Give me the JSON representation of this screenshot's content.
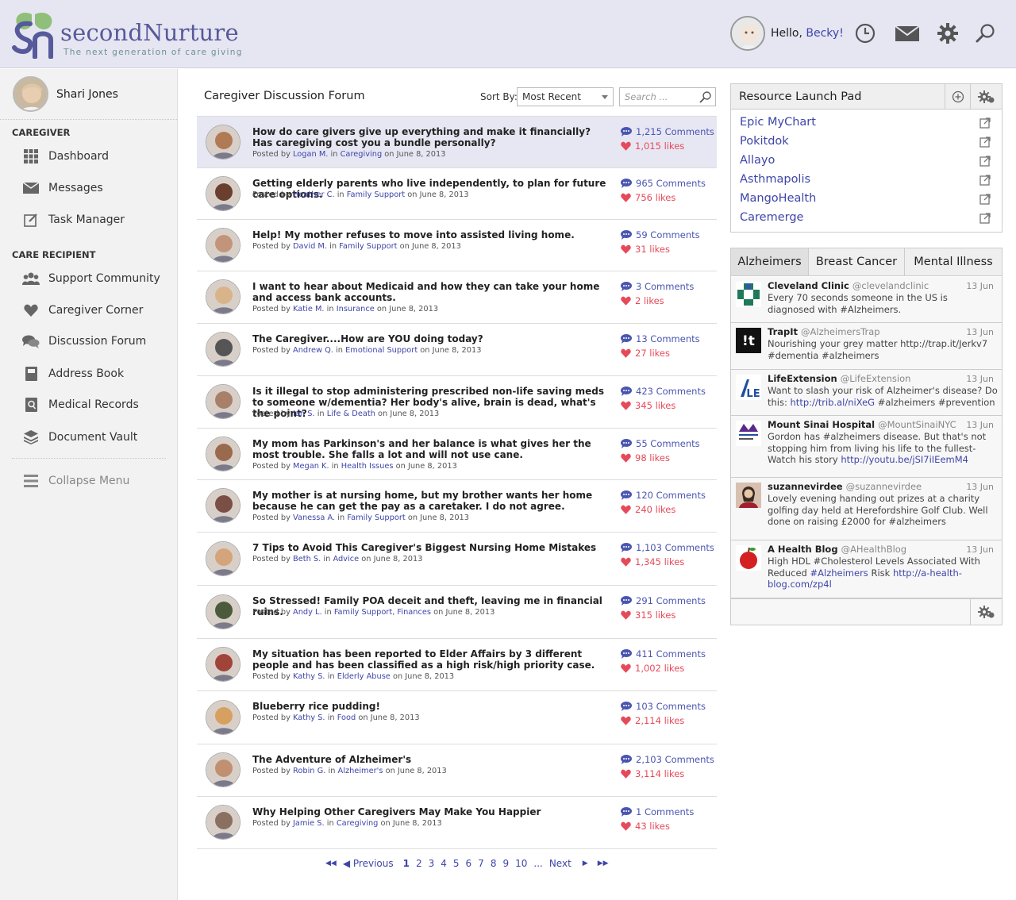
{
  "app": {
    "name": "secondNurture",
    "tagline": "The next generation of care giving",
    "accent_color": "#56599a",
    "link_color": "#3e45a8"
  },
  "header": {
    "greeting": "Hello,",
    "user_name": "Becky!",
    "icons": [
      "clock-icon",
      "mail-icon",
      "gear-icon",
      "search-icon"
    ]
  },
  "sidebar": {
    "profile_name": "Shari Jones",
    "caregiver_heading": "CAREGIVER",
    "caregiver_items": [
      {
        "label": "Dashboard",
        "icon": "grid-icon"
      },
      {
        "label": "Messages",
        "icon": "mail-icon"
      },
      {
        "label": "Task Manager",
        "icon": "edit-icon"
      }
    ],
    "recipient_heading": "CARE RECIPIENT",
    "recipient_items": [
      {
        "label": "Support Community",
        "icon": "people-icon"
      },
      {
        "label": "Caregiver Corner",
        "icon": "heart-icon"
      },
      {
        "label": "Discussion Forum",
        "icon": "chat-icon"
      },
      {
        "label": "Address Book",
        "icon": "book-icon"
      },
      {
        "label": "Medical Records",
        "icon": "records-icon"
      },
      {
        "label": "Document Vault",
        "icon": "layers-icon"
      }
    ],
    "collapse_label": "Collapse Menu"
  },
  "forum": {
    "title": "Caregiver Discussion Forum",
    "sort_label": "Sort By:",
    "sort_value": "Most Recent",
    "search_placeholder": "Search ...",
    "posts": [
      {
        "title": "How do care givers give up everything and make it financially? Has caregiving cost you a bundle personally?",
        "author": "Logan M.",
        "category": "Caregiving",
        "date": "June 8, 2013",
        "comments": "1,215 Comments",
        "likes": "1,015 likes",
        "color": "#b07a55"
      },
      {
        "title": "Getting elderly parents who live independently, to plan for future care options.",
        "author": "Heather C.",
        "category": "Family Support",
        "date": "June 8, 2013",
        "comments": "965 Comments",
        "likes": "756 likes",
        "color": "#6b3f2e"
      },
      {
        "title": "Help! My mother refuses to move into assisted living home.",
        "author": "David M.",
        "category": "Family Support",
        "date": "June 8, 2013",
        "comments": "59 Comments",
        "likes": "31 likes",
        "color": "#c2957a"
      },
      {
        "title": "I want to hear about Medicaid and how they can take your home and access bank accounts.",
        "author": "Katie M.",
        "category": "Insurance",
        "date": "June 8, 2013",
        "comments": "3 Comments",
        "likes": "2 likes",
        "color": "#d9b48a"
      },
      {
        "title": "The Caregiver....How are YOU doing today?",
        "author": "Andrew Q.",
        "category": "Emotional Support",
        "date": "June 8, 2013",
        "comments": "13 Comments",
        "likes": "27 likes",
        "color": "#555555"
      },
      {
        "title": "Is it illegal to stop administering prescribed non-life saving meds to someone w/dementia? Her body's alive, brain is dead, what's the point?",
        "author": "Ian S.",
        "category": "Life & Death",
        "date": "June 8, 2013",
        "comments": "423 Comments",
        "likes": "345 likes",
        "color": "#a8806a"
      },
      {
        "title": "My mom has Parkinson's and her balance is what gives her the most trouble. She falls a lot and will not use cane.",
        "author": "Megan K.",
        "category": "Health Issues",
        "date": "June 8, 2013",
        "comments": "55 Comments",
        "likes": "98 likes",
        "color": "#9a6a4e"
      },
      {
        "title": "My mother is at nursing home, but my brother wants her home because he can get the pay as a caretaker. I do not agree.",
        "author": "Vanessa A.",
        "category": "Family Support",
        "date": "June 8, 2013",
        "comments": "120 Comments",
        "likes": "240 likes",
        "color": "#7a4f45"
      },
      {
        "title": "7 Tips to Avoid This Caregiver's Biggest Nursing Home Mistakes",
        "author": "Beth S.",
        "category": "Advice",
        "date": "June 8, 2013",
        "comments": "1,103 Comments",
        "likes": "1,345 likes",
        "color": "#d4a47c"
      },
      {
        "title": "So Stressed! Family POA deceit and theft, leaving me in financial ruins.",
        "author": "Andy L.",
        "category": "Family Support",
        "category2": "Finances",
        "date": "June 8, 2013",
        "comments": "291 Comments",
        "likes": "315 likes",
        "color": "#4a5a3a"
      },
      {
        "title": "My situation has been reported to Elder Affairs by 3 different people and has been classified as a high risk/high priority case.",
        "author": "Kathy S.",
        "category": "Elderly Abuse",
        "date": "June 8, 2013",
        "comments": "411 Comments",
        "likes": "1,002 likes",
        "color": "#a0443a"
      },
      {
        "title": "Blueberry rice pudding!",
        "author": "Kathy S.",
        "category": "Food",
        "date": "June 8, 2013",
        "comments": "103 Comments",
        "likes": "2,114 likes",
        "color": "#d8a060"
      },
      {
        "title": "The Adventure of Alzheimer's",
        "author": "Robin G.",
        "category": "Alzheimer's",
        "date": "June 8, 2013",
        "comments": "2,103 Comments",
        "likes": "3,114 likes",
        "color": "#c09070"
      },
      {
        "title": "Why Helping Other Caregivers May Make You Happier",
        "author": "Jamie S.",
        "category": "Caregiving",
        "date": "June 8, 2013",
        "comments": "1 Comments",
        "likes": "43 likes",
        "color": "#8a7060"
      }
    ],
    "posted_by": "Posted by",
    "in_word": "in",
    "on_word": "on"
  },
  "pager": {
    "first": "◀◀",
    "prev": "◀ Previous",
    "pages": [
      "1",
      "2",
      "3",
      "4",
      "5",
      "6",
      "7",
      "8",
      "9",
      "10"
    ],
    "ellipsis": "...",
    "next": "Next",
    "next_arrow": "▶",
    "last": "▶▶"
  },
  "launchpad": {
    "title": "Resource Launch Pad",
    "items": [
      "Epic MyChart",
      "Pokitdok",
      "Allayo",
      "Asthmapolis",
      "MangoHealth",
      "Caremerge"
    ]
  },
  "twitter": {
    "tabs": [
      "Alzheimers",
      "Breast Cancer",
      "Mental Illness"
    ],
    "tweets": [
      {
        "name": "Cleveland Clinic",
        "handle": "@clevelandclinic",
        "date": "13 Jun",
        "text": "Every 70 seconds someone in the US is diagnosed with #Alzheimers."
      },
      {
        "name": "TrapIt",
        "handle": "@AlzheimersTrap",
        "date": "13 Jun",
        "text": "Nourishing your grey matter http://trap.it/Jerkv7 #dementia #alzheimers"
      },
      {
        "name": "LifeExtension",
        "handle": "@LifeExtension",
        "date": "13 Jun",
        "text_pre": "Want to slash your risk of Alzheimer's disease? Do this: ",
        "link": "http://trib.al/niXeG",
        "text_post": " #alzheimers #prevention"
      },
      {
        "name": "Mount Sinai Hospital",
        "handle": "@MountSinaiNYC",
        "date": "13 Jun",
        "text_pre": "Gordon has #alzheimers disease. But that's not stopping him from living his life to the fullest-Watch his story ",
        "link": "http://youtu.be/jSI7iIEemM4",
        "text_post": ""
      },
      {
        "name": "suzannevirdee",
        "handle": "@suzannevirdee",
        "date": "13 Jun",
        "text": "Lovely evening handing out prizes at a charity golfing day held at Herefordshire Golf Club. Well done on raising £2000 for #alzheimers"
      },
      {
        "name": "A Health Blog",
        "handle": "@AHealthBlog",
        "date": "13 Jun",
        "text_pre": "High HDL #Cholesterol Levels Associated With Reduced ",
        "link": "#Alzheimers",
        "text_mid": " Risk ",
        "link2": "http://a-health-blog.com/zp4l"
      }
    ]
  }
}
